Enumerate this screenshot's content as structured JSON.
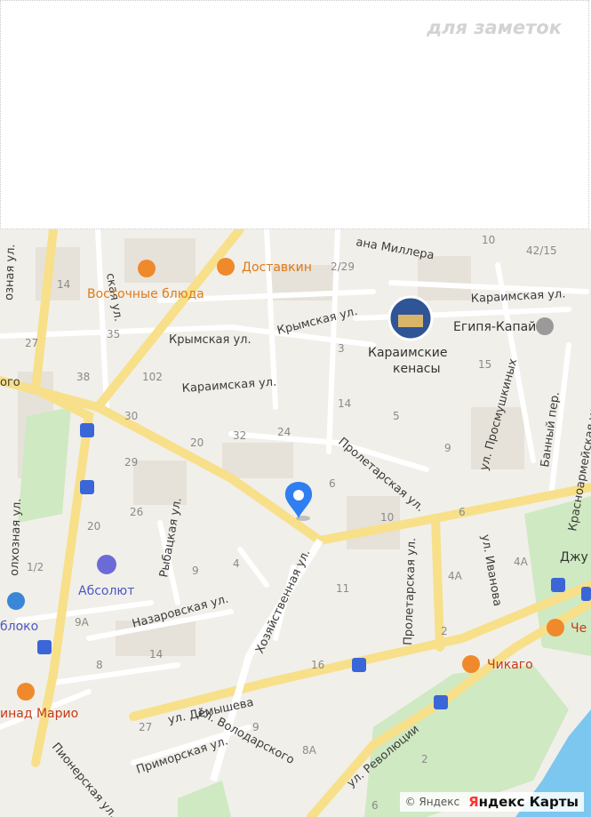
{
  "notes": {
    "label": "для заметок"
  },
  "map": {
    "streets": {
      "volodarskogo": "ул. Володарского",
      "demysheva": "ул. Дёмышева",
      "revolyutsii": "ул. Революции",
      "krymskaya_1": "Крымская ул.",
      "krymskaya_2": "Крымская ул.",
      "karaimskaya_1": "Караимская ул.",
      "karaimskaya_2": "Караимская ул.",
      "proletarskaya_1": "Пролетарская ул.",
      "proletarskaya_2": "Пролетарская ул.",
      "khozyaystvennaya": "Хозяйственная ул.",
      "nazarovskaya": "Назаровская ул.",
      "rybatskaya": "Рыбацкая ул.",
      "primorskaya": "Приморская ул.",
      "pionerskaya": "Пионерская ул.",
      "prosmushkinykh": "ул. Просмушкиных",
      "ivanova": "ул. Иванова",
      "bannyy": "Банный пер.",
      "krasnoarmeyskaya": "Красноармейская ул.",
      "millera": "ана Миллера",
      "kolkhoznaya": "олхозная ул.",
      "kolkhoznaya_top": "озная ул.",
      "ckaya": "ская ул.",
      "go": "ого"
    },
    "pois": {
      "vostochnye": "Восточные блюда",
      "dostavkin": "Доставкин",
      "kenasy_1": "Караимские",
      "kenasy_2": "кенасы",
      "egiya": "Египя-Капай",
      "absolyut": "Абсолют",
      "chikago": "Чикаго",
      "mario": "инад Марио",
      "yabloko": "блоко",
      "dzhu": "Джу",
      "che": "Че"
    },
    "house_numbers": [
      "10",
      "42/15",
      "14",
      "2/29",
      "27",
      "35",
      "38",
      "102",
      "30",
      "20",
      "32",
      "24",
      "14",
      "5",
      "3",
      "15",
      "9",
      "6",
      "29",
      "26",
      "20",
      "10",
      "6",
      "1/2",
      "9",
      "4",
      "4A",
      "4A",
      "11",
      "9A",
      "14",
      "8",
      "16",
      "2",
      "27",
      "9",
      "8A",
      "2",
      "6",
      "1"
    ]
  },
  "copyright": {
    "text": "© Яндекс",
    "brand_first": "Я",
    "brand_rest": "ндекс Карты"
  },
  "colors": {
    "road": "#f7e089",
    "background": "#f1efe9",
    "park": "#cfe9c2",
    "sea": "#7cc7f0",
    "pin": "#2f7ff0"
  }
}
